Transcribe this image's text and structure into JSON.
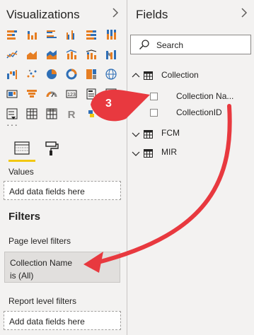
{
  "visualizations": {
    "title": "Visualizations",
    "more": "···",
    "icons": [
      "stacked-bar-chart-icon",
      "stacked-column-chart-icon",
      "clustered-bar-chart-icon",
      "clustered-column-chart-icon",
      "100-stacked-bar-chart-icon",
      "100-stacked-column-chart-icon",
      "line-chart-icon",
      "area-chart-icon",
      "stacked-area-chart-icon",
      "line-and-column-chart-icon",
      "line-and-stacked-column-chart-icon",
      "ribbon-chart-icon",
      "waterfall-chart-icon",
      "scatter-chart-icon",
      "pie-chart-icon",
      "donut-chart-icon",
      "treemap-icon",
      "map-icon",
      "filled-map-icon",
      "funnel-icon",
      "gauge-icon",
      "card-icon",
      "multi-row-card-icon",
      "kpi-icon",
      "slicer-icon",
      "table-icon",
      "matrix-icon",
      "r-visual-icon",
      "python-visual-icon",
      "globe-icon"
    ],
    "tabs": [
      "fields-tab-icon",
      "format-paint-roller-icon"
    ],
    "values_label": "Values",
    "values_well": "Add data fields here"
  },
  "filters": {
    "heading": "Filters",
    "page_level_label": "Page level filters",
    "page_filter": {
      "line1": "Collection Name",
      "line2": "is (All)"
    },
    "report_level_label": "Report level filters",
    "report_well": "Add data fields here"
  },
  "fields": {
    "title": "Fields",
    "search_placeholder": "Search",
    "tables": [
      {
        "name": "Collection",
        "expanded": true,
        "fields": [
          "Collection Na...",
          "CollectionID"
        ]
      },
      {
        "name": "FCM",
        "expanded": false,
        "fields": []
      },
      {
        "name": "MIR",
        "expanded": false,
        "fields": []
      }
    ]
  },
  "annotation": {
    "step": "3",
    "color": "#e8393f"
  },
  "colors": {
    "accent_yellow": "#f2c811",
    "viz_orange": "#e67e22",
    "viz_blue": "#2f6fb6",
    "pane_bg": "#f3f2f1"
  }
}
